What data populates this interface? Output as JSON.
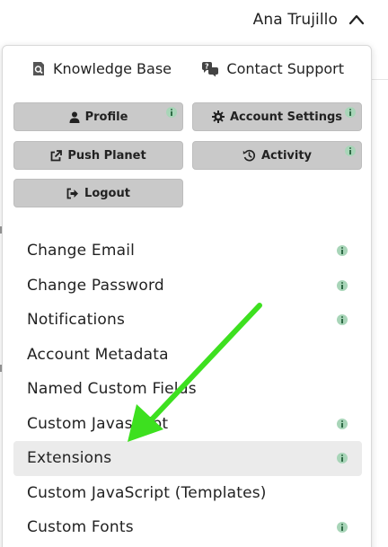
{
  "header": {
    "user_name": "Ana Trujillo"
  },
  "top_links": {
    "knowledge_base": "Knowledge Base",
    "contact_support": "Contact Support"
  },
  "buttons": {
    "profile": "Profile",
    "account_settings": "Account Settings",
    "push_planet": "Push Planet",
    "activity": "Activity",
    "logout": "Logout"
  },
  "menu": {
    "items": [
      {
        "label": "Change Email",
        "info": true
      },
      {
        "label": "Change Password",
        "info": true
      },
      {
        "label": "Notifications",
        "info": true
      },
      {
        "label": "Account Metadata",
        "info": false
      },
      {
        "label": "Named Custom Fields",
        "info": false
      },
      {
        "label": "Custom Javascript",
        "info": true
      },
      {
        "label": "Extensions",
        "info": true,
        "active": true
      },
      {
        "label": "Custom JavaScript (Templates)",
        "info": false
      },
      {
        "label": "Custom Fonts",
        "info": true
      }
    ]
  },
  "colors": {
    "button_bg": "#c9c9c9",
    "info_badge": "#a8d5b8",
    "active_item_bg": "#ebebeb",
    "annotation_arrow": "#3de01f"
  },
  "icons": {
    "chevron": "chevron-up-icon",
    "knowledge_base": "book-search-icon",
    "contact_support": "chat-question-icon",
    "profile": "user-icon",
    "account_settings": "gear-icon",
    "push_planet": "external-link-icon",
    "activity": "history-icon",
    "logout": "sign-out-icon",
    "info": "info-icon"
  }
}
